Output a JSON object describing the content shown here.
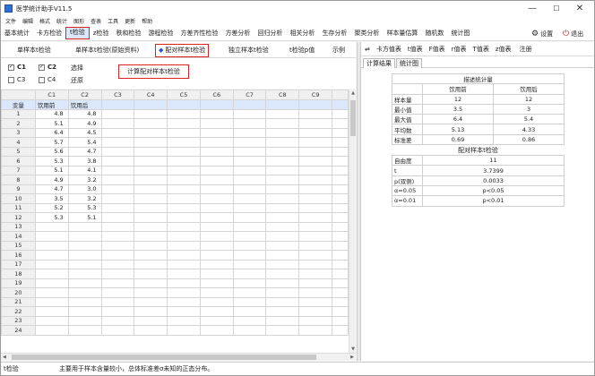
{
  "window": {
    "title": "医学统计助手V11.5",
    "minimize": "—",
    "maximize": "☐",
    "close": "✕"
  },
  "menu": [
    "文件",
    "编辑",
    "格式",
    "统计",
    "图形",
    "查表",
    "工具",
    "更新",
    "帮助"
  ],
  "modules": [
    "基本统计",
    "卡方检验",
    "t检验",
    "z检验",
    "秩和检验",
    "游程检验",
    "方差齐性检验",
    "方差分析",
    "回归分析",
    "相关分析",
    "生存分析",
    "聚类分析",
    "样本量估算",
    "随机数",
    "统计图"
  ],
  "active_module": "t检验",
  "toolbar_right": {
    "settings": "设置",
    "exit": "退出"
  },
  "subtabs": [
    "单样本t检验",
    "单样本t检验(原始资料)",
    "配对样本t检验",
    "独立样本t检验",
    "t检验p值",
    "示例"
  ],
  "active_subtab": "配对样本t检验",
  "columns_select": {
    "c1": "C1",
    "c2": "C2",
    "c3": "C3",
    "c4": "C4",
    "select": "选择",
    "restore": "还原"
  },
  "calc_button": "计算配对样本t检验",
  "grid": {
    "headers": [
      "",
      "C1",
      "C2",
      "C3",
      "C4",
      "C5",
      "C6",
      "C7",
      "C8",
      "C9"
    ],
    "var_row": [
      "变量",
      "饮用前",
      "饮用后"
    ],
    "rows": [
      [
        "1",
        "4.8",
        "4.8"
      ],
      [
        "2",
        "5.1",
        "4.9"
      ],
      [
        "3",
        "6.4",
        "4.5"
      ],
      [
        "4",
        "5.7",
        "5.4"
      ],
      [
        "5",
        "5.6",
        "4.7"
      ],
      [
        "6",
        "5.3",
        "3.8"
      ],
      [
        "7",
        "5.1",
        "4.1"
      ],
      [
        "8",
        "4.9",
        "3.2"
      ],
      [
        "9",
        "4.7",
        "3.0"
      ],
      [
        "10",
        "3.5",
        "3.2"
      ],
      [
        "11",
        "5.2",
        "5.3"
      ],
      [
        "12",
        "5.3",
        "5.1"
      ],
      [
        "13",
        "",
        ""
      ],
      [
        "14",
        "",
        ""
      ],
      [
        "15",
        "",
        ""
      ],
      [
        "16",
        "",
        ""
      ],
      [
        "17",
        "",
        ""
      ],
      [
        "18",
        "",
        ""
      ],
      [
        "19",
        "",
        ""
      ],
      [
        "20",
        "",
        ""
      ],
      [
        "21",
        "",
        ""
      ],
      [
        "22",
        "",
        ""
      ],
      [
        "23",
        "",
        ""
      ],
      [
        "24",
        "",
        ""
      ]
    ]
  },
  "right_tools": [
    "⇌",
    "卡方值表",
    "t值表",
    "F值表",
    "r值表",
    "T值表",
    "z值表",
    "注册"
  ],
  "result_tabs": [
    "计算结果",
    "统计图"
  ],
  "results": {
    "desc_title": "描述统计量",
    "group_headers": [
      "",
      "饮用前",
      "饮用后"
    ],
    "desc_rows": [
      [
        "样本量",
        "12",
        "12"
      ],
      [
        "最小值",
        "3.5",
        "3"
      ],
      [
        "最大值",
        "6.4",
        "5.4"
      ],
      [
        "平均数",
        "5.13",
        "4.33"
      ],
      [
        "标准差",
        "0.69",
        "0.86"
      ]
    ],
    "test_title": "配对样本t检验",
    "test_rows": [
      [
        "自由度",
        "11"
      ],
      [
        "t",
        "3.7399"
      ],
      [
        "p(双侧)",
        "0.0033"
      ],
      [
        "α=0.05",
        "p<0.05"
      ],
      [
        "α=0.01",
        "p<0.01"
      ]
    ]
  },
  "status": {
    "left": "t检验",
    "message": "主要用于样本含量较小，总体标准差σ未知的正态分布。"
  }
}
